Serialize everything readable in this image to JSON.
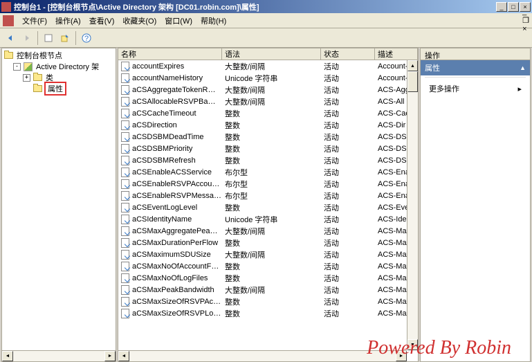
{
  "window": {
    "title": "控制台1 - [控制台根节点\\Active Directory 架构 [DC01.robin.com]\\属性]"
  },
  "menu": {
    "file": "文件(F)",
    "action": "操作(A)",
    "view": "查看(V)",
    "favorites": "收藏夹(O)",
    "window": "窗口(W)",
    "help": "帮助(H)"
  },
  "tree": {
    "root": "控制台根节点",
    "ad": "Active Directory 架",
    "classes": "类",
    "attributes": "属性"
  },
  "columns": {
    "name": "名称",
    "syntax": "语法",
    "status": "状态",
    "desc": "描述"
  },
  "rows": [
    {
      "name": "accountExpires",
      "syntax": "大整数/间隔",
      "status": "活动",
      "desc": "Account-"
    },
    {
      "name": "accountNameHistory",
      "syntax": "Unicode 字符串",
      "status": "活动",
      "desc": "Account-"
    },
    {
      "name": "aCSAggregateTokenR…",
      "syntax": "大整数/间隔",
      "status": "活动",
      "desc": "ACS-Agg"
    },
    {
      "name": "aCSAllocableRSVPBa…",
      "syntax": "大整数/间隔",
      "status": "活动",
      "desc": "ACS-All"
    },
    {
      "name": "aCSCacheTimeout",
      "syntax": "整数",
      "status": "活动",
      "desc": "ACS-Cac"
    },
    {
      "name": "aCSDirection",
      "syntax": "整数",
      "status": "活动",
      "desc": "ACS-Dir"
    },
    {
      "name": "aCSDSBMDeadTime",
      "syntax": "整数",
      "status": "活动",
      "desc": "ACS-DSB"
    },
    {
      "name": "aCSDSBMPriority",
      "syntax": "整数",
      "status": "活动",
      "desc": "ACS-DSB"
    },
    {
      "name": "aCSDSBMRefresh",
      "syntax": "整数",
      "status": "活动",
      "desc": "ACS-DSB"
    },
    {
      "name": "aCSEnableACSService",
      "syntax": "布尔型",
      "status": "活动",
      "desc": "ACS-Ena"
    },
    {
      "name": "aCSEnableRSVPAccou…",
      "syntax": "布尔型",
      "status": "活动",
      "desc": "ACS-Ena"
    },
    {
      "name": "aCSEnableRSVPMessa…",
      "syntax": "布尔型",
      "status": "活动",
      "desc": "ACS-Ena"
    },
    {
      "name": "aCSEventLogLevel",
      "syntax": "整数",
      "status": "活动",
      "desc": "ACS-Eve"
    },
    {
      "name": "aCSIdentityName",
      "syntax": "Unicode 字符串",
      "status": "活动",
      "desc": "ACS-Ide"
    },
    {
      "name": "aCSMaxAggregatePea…",
      "syntax": "大整数/间隔",
      "status": "活动",
      "desc": "ACS-Max"
    },
    {
      "name": "aCSMaxDurationPerFlow",
      "syntax": "整数",
      "status": "活动",
      "desc": "ACS-Max"
    },
    {
      "name": "aCSMaximumSDUSize",
      "syntax": "大整数/间隔",
      "status": "活动",
      "desc": "ACS-Max"
    },
    {
      "name": "aCSMaxNoOfAccountF…",
      "syntax": "整数",
      "status": "活动",
      "desc": "ACS-Max"
    },
    {
      "name": "aCSMaxNoOfLogFiles",
      "syntax": "整数",
      "status": "活动",
      "desc": "ACS-Max"
    },
    {
      "name": "aCSMaxPeakBandwidth",
      "syntax": "大整数/间隔",
      "status": "活动",
      "desc": "ACS-Max"
    },
    {
      "name": "aCSMaxSizeOfRSVPAc…",
      "syntax": "整数",
      "status": "活动",
      "desc": "ACS-Max"
    },
    {
      "name": "aCSMaxSizeOfRSVPLo…",
      "syntax": "整数",
      "status": "活动",
      "desc": "ACS-Max"
    }
  ],
  "actions": {
    "header": "操作",
    "title": "属性",
    "more": "更多操作"
  },
  "watermark": "Powered By Robin"
}
